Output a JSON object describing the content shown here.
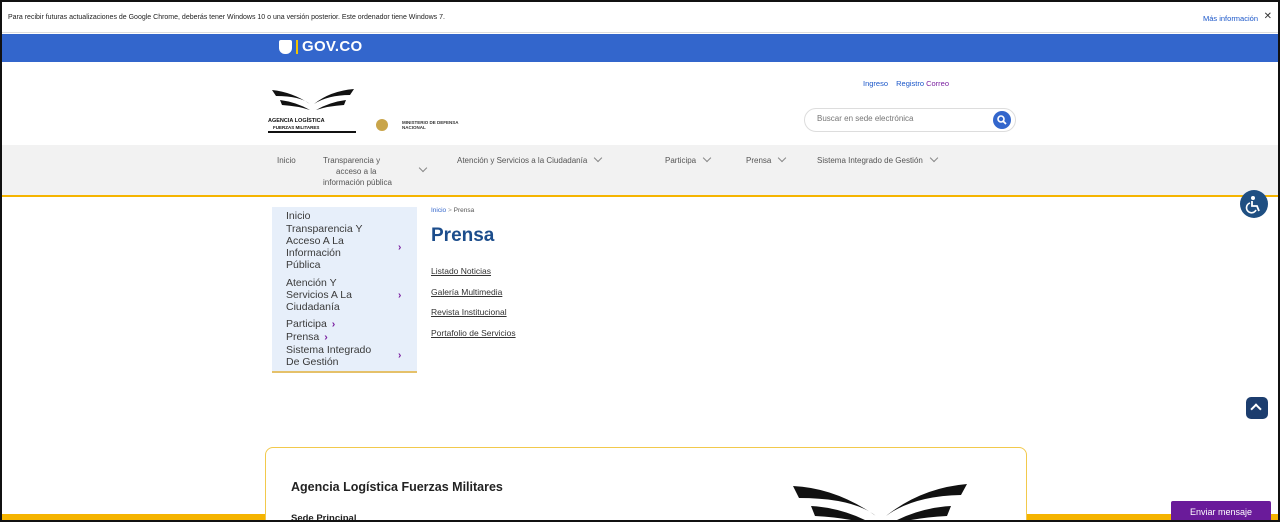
{
  "chrome_notice": {
    "text": "Para recibir futuras actualizaciones de Google Chrome, deberás tener Windows 10 o una versión posterior. Este ordenador tiene Windows 7.",
    "link": "Más información",
    "close": "✕"
  },
  "gov_bar": {
    "logo_text": "GOV.CO"
  },
  "header": {
    "agency_logo_line1": "AGENCIA LOGÍSTICA",
    "agency_logo_line2": "FUERZAS MILITARES",
    "ministry_line1": "MINISTERIO DE DEFENSA",
    "ministry_line2": "NACIONAL",
    "links": {
      "login": "Ingreso",
      "register": "Registro",
      "mail": "Correo"
    },
    "search_placeholder": "Buscar en sede electrónica"
  },
  "nav": {
    "inicio": "Inicio",
    "transparencia_l1": "Transparencia y",
    "transparencia_l2": "acceso a la",
    "transparencia_l3": "información pública",
    "atencion": "Atención y Servicios a la Ciudadanía",
    "participa": "Participa",
    "prensa": "Prensa",
    "sig": "Sistema Integrado de Gestión"
  },
  "sidebar": {
    "inicio": "Inicio",
    "trans1": "Transparencia Y",
    "trans2": "Acceso A La",
    "trans3": "Información",
    "trans4": "Pública",
    "aten1": "Atención Y",
    "aten2": "Servicios A La",
    "aten3": "Ciudadanía",
    "participa": "Participa",
    "prensa": "Prensa",
    "sig1": "Sistema Integrado",
    "sig2": "De Gestión"
  },
  "breadcrumb": {
    "home": "Inicio",
    "sep": " > ",
    "current": "Prensa"
  },
  "page_title": "Prensa",
  "content_links": [
    "Listado Noticias",
    "Galería Multimedia",
    "Revista Institucional",
    "Portafolio de Servicios"
  ],
  "footer": {
    "org_name": "Agencia Logística Fuerzas Militares",
    "sede": "Sede Principal"
  },
  "message_button": "Enviar mensaje",
  "colors": {
    "gov_blue": "#3366cc",
    "accent_yellow": "#f5b400",
    "title_blue": "#1c4d8c",
    "purple": "#6a1b9a"
  }
}
